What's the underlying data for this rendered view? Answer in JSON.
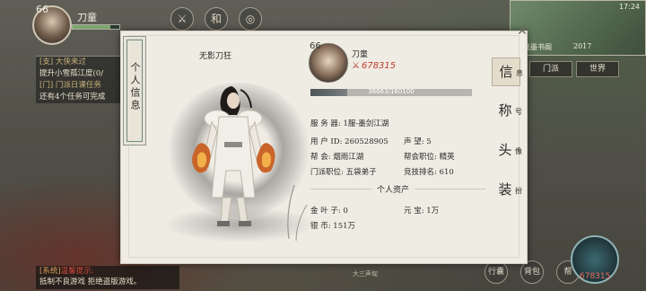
{
  "hud": {
    "player_level": "66",
    "player_name": "刀童",
    "minimap": {
      "time": "17:24",
      "location": "洗墨书阁",
      "coord": "2017"
    },
    "right_tabs": [
      "门派",
      "世界"
    ],
    "top_icons": [
      "⚔",
      "和",
      "◎"
    ],
    "quests": [
      {
        "text": "[支] 大侠来过",
        "highlight": true
      },
      {
        "text": "提升小雪孤江度(0/",
        "highlight": false
      },
      {
        "text": "[门] 门派日课任务",
        "highlight": true
      },
      {
        "text": "还有4个任务可完成",
        "highlight": false
      }
    ],
    "chat": [
      {
        "parts": [
          {
            "text": "[系统]",
            "cls": "sys"
          },
          {
            "text": "温馨提示:",
            "cls": "red"
          }
        ]
      },
      {
        "parts": [
          {
            "text": "抵制不良游戏  拒绝盗版游戏。",
            "cls": ""
          }
        ]
      }
    ],
    "bottom_icons": [
      "行囊",
      "背包",
      "帮"
    ],
    "skill_power": "678315"
  },
  "panel": {
    "side_label": "个人信息",
    "char_title": "无影刀狂",
    "avatar_level": "66",
    "name": "刀童",
    "power": "678315",
    "hp": {
      "current": 36663,
      "max": 160100,
      "label": "36663/160100",
      "fill": 0.23
    },
    "info": {
      "server_label": "服 务 器:",
      "server": "1服-墨剑江湖",
      "uid_label": "用 户 ID:",
      "uid": "260528905",
      "reputation_label": "声   望:",
      "reputation": "5",
      "guild_label": "帮   会:",
      "guild": "烟雨江湖",
      "guild_rank_label": "帮会职位:",
      "guild_rank": "精英",
      "sect_rank_label": "门派职位:",
      "sect_rank": "五袋弟子",
      "arena_label": "竞技排名:",
      "arena": "610"
    },
    "assets_title": "个人资产",
    "assets": {
      "gold_leaf_label": "金 叶 子:",
      "gold_leaf": "0",
      "yuanbao_label": "元   宝:",
      "yuanbao": "1万",
      "silver_label": "银   币:",
      "silver": "151万"
    },
    "tabs": [
      {
        "label": "信",
        "sub": "息",
        "active": true
      },
      {
        "label": "称",
        "sub": "号",
        "active": false
      },
      {
        "label": "头",
        "sub": "像",
        "active": false
      },
      {
        "label": "装",
        "sub": "扮",
        "active": false
      }
    ],
    "close": "✕",
    "footer_note": "大三声甸"
  }
}
